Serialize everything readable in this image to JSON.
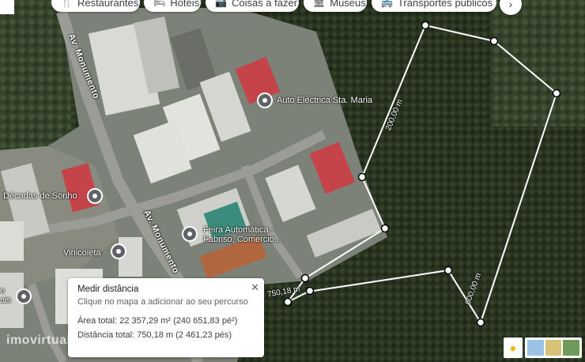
{
  "chips": [
    {
      "icon": "restaurant-icon",
      "glyph": "🍴",
      "label": "Restaurantes"
    },
    {
      "icon": "hotel-icon",
      "glyph": "🛏",
      "label": "Hotéis"
    },
    {
      "icon": "camera-icon",
      "glyph": "📷",
      "label": "Coisas a fazer"
    },
    {
      "icon": "museum-icon",
      "glyph": "🏛",
      "label": "Museus"
    },
    {
      "icon": "transit-icon",
      "glyph": "🚌",
      "label": "Transportes públicos"
    }
  ],
  "poi": {
    "auto_electrica": "Auto Eléctrica Sta. Maria",
    "decadas": "Décadas de Sonho",
    "feira_line1": "Feira Automática -",
    "feira_line2": "Fabriso, Comércio...",
    "vinicoleta": "Vinicoleta",
    "partial_left": "e",
    "partial_left2": "ais"
  },
  "roads": {
    "north": "Av. Monumento",
    "south": "Av. Monumento"
  },
  "distances": {
    "seg_200": "200,00 m",
    "seg_600": "600,00 m",
    "seg_total": "750,18 m"
  },
  "panel": {
    "title": "Medir distância",
    "hint": "Clique no mapa a adicionar ao seu percurso",
    "area": "Área total: 22 357,29 m² (240 651,83 pé²)",
    "distance": "Distância total: 750,18 m (2 461,23 pés)"
  },
  "watermark": "imovirtual",
  "colors": {
    "forest": "#27331f",
    "industrial": "#7d8278",
    "red_roof": "#c5444a",
    "measure_line": "#ffffff"
  }
}
